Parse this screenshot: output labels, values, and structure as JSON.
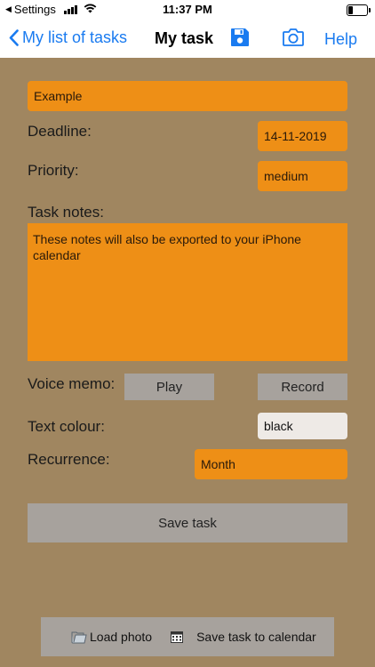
{
  "status": {
    "carrier": "Settings",
    "time": "11:37 PM"
  },
  "nav": {
    "back_label": "My list of tasks",
    "title": "My task",
    "help_label": "Help",
    "save_icon": "floppy-disk-icon",
    "camera_icon": "camera-icon"
  },
  "task": {
    "name": "Example",
    "deadline_label": "Deadline:",
    "deadline_value": "14-11-2019",
    "priority_label": "Priority:",
    "priority_value": "medium",
    "notes_label": "Task notes:",
    "notes_value": "These notes will also be exported to your iPhone calendar",
    "voice_memo_label": "Voice memo:",
    "play_label": "Play",
    "record_label": "Record",
    "text_colour_label": "Text colour:",
    "text_colour_value": "black",
    "recurrence_label": "Recurrence:",
    "recurrence_value": "Month",
    "save_label": "Save task"
  },
  "bottom": {
    "load_photo_label": "Load photo",
    "save_calendar_label": "Save task to calendar"
  },
  "colors": {
    "background": "#a08660",
    "field": "#ee8f16",
    "button": "#a7a29d",
    "accent": "#1a7bf0"
  }
}
